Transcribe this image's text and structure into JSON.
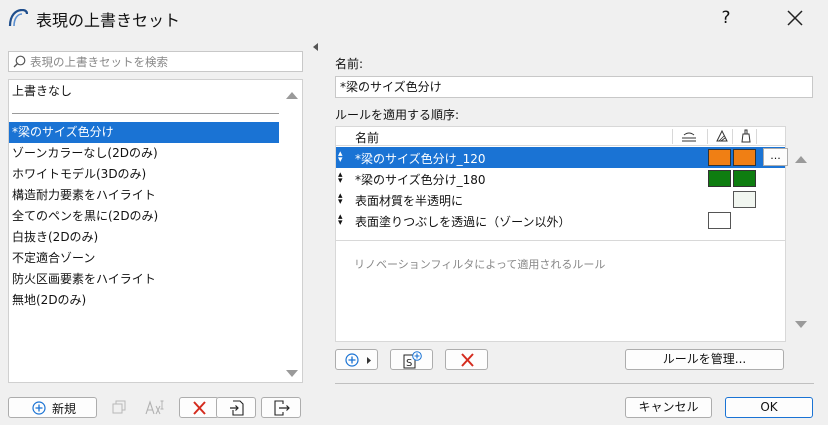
{
  "window": {
    "title": "表現の上書きセット",
    "help": "?"
  },
  "search": {
    "placeholder": "表現の上書きセットを検索"
  },
  "list": {
    "top_item": "上書きなし",
    "items": [
      {
        "label": "*梁のサイズ色分け",
        "selected": true
      },
      {
        "label": "ゾーンカラーなし(2Dのみ)"
      },
      {
        "label": "ホワイトモデル(3Dのみ)"
      },
      {
        "label": "構造耐力要素をハイライト"
      },
      {
        "label": "全てのペンを黒に(2Dのみ)"
      },
      {
        "label": "白抜き(2Dのみ)"
      },
      {
        "label": "不定適合ゾーン"
      },
      {
        "label": "防火区画要素をハイライト"
      },
      {
        "label": "無地(2Dのみ)"
      }
    ]
  },
  "left_toolbar": {
    "new_label": "新規"
  },
  "right": {
    "name_label": "名前:",
    "name_value": "*梁のサイズ色分け",
    "order_label": "ルールを適用する順序:",
    "column_name": "名前",
    "rules": [
      {
        "name": "*梁のサイズ色分け_120",
        "selected": true,
        "fill1": "#f07f14",
        "fill2": "#f07f14"
      },
      {
        "name": "*梁のサイズ色分け_180",
        "fill1": "#0e7d10",
        "fill2": "#0e7d10"
      },
      {
        "name": "表面材質を半透明に",
        "fill1": null,
        "fill2": "#f1f6f0"
      },
      {
        "name": "表面塗りつぶしを透過に（ゾーン以外）",
        "fill1": "#ffffff",
        "fill2": null
      }
    ],
    "more_label": "...",
    "hint": "リノベーションフィルタによって適用されるルール",
    "manage_label": "ルールを管理..."
  },
  "footer": {
    "cancel_label": "キャンセル",
    "ok_label": "OK"
  },
  "colors": {
    "selection": "#1a73d4",
    "delete_red": "#d42b1e",
    "add_blue": "#1a73d4"
  }
}
